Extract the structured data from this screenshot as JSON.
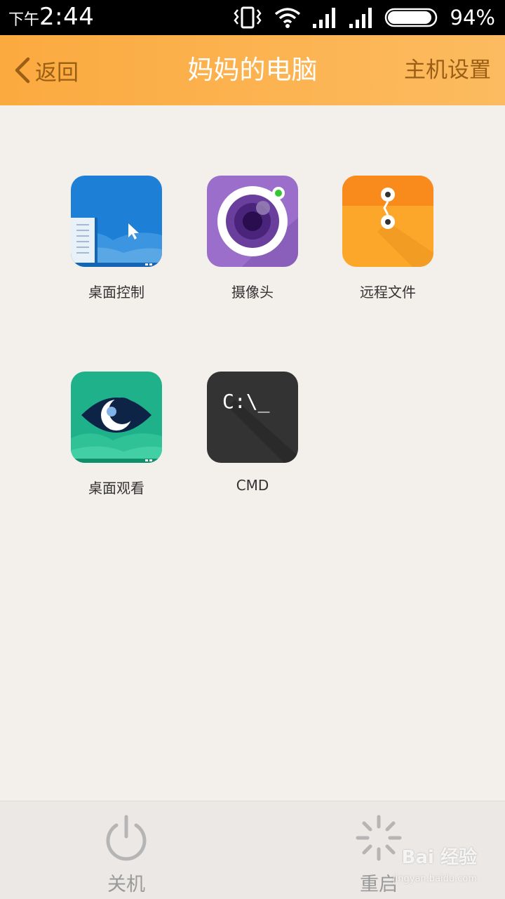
{
  "status_bar": {
    "time_prefix": "下午",
    "time": "2:44",
    "battery_percent": "94%",
    "battery_level": 0.94,
    "icons": [
      "vibrate-icon",
      "wifi-icon",
      "signal-icon",
      "signal-icon",
      "battery-icon"
    ]
  },
  "header": {
    "back_label": "返回",
    "title": "妈妈的电脑",
    "settings_label": "主机设置",
    "colors": {
      "bar": "#fbaa3f",
      "action_text": "#9a5f15",
      "title_text": "#ffffff"
    }
  },
  "tiles": [
    {
      "label": "桌面控制",
      "icon": "desktop-control-icon",
      "color": "#1e7fd6"
    },
    {
      "label": "摄像头",
      "icon": "camera-icon",
      "color": "#9b6ecb"
    },
    {
      "label": "远程文件",
      "icon": "remote-file-icon",
      "color": "#fca62a"
    },
    {
      "label": "桌面观看",
      "icon": "desktop-view-icon",
      "color": "#1fb189"
    },
    {
      "label": "CMD",
      "icon": "cmd-icon",
      "color": "#333333",
      "glyph": "C:\\_"
    }
  ],
  "bottom_bar": {
    "shutdown_label": "关机",
    "restart_label": "重启"
  },
  "watermark": {
    "text": "Bai 经验",
    "sub": "jingyan.baidu.com"
  }
}
